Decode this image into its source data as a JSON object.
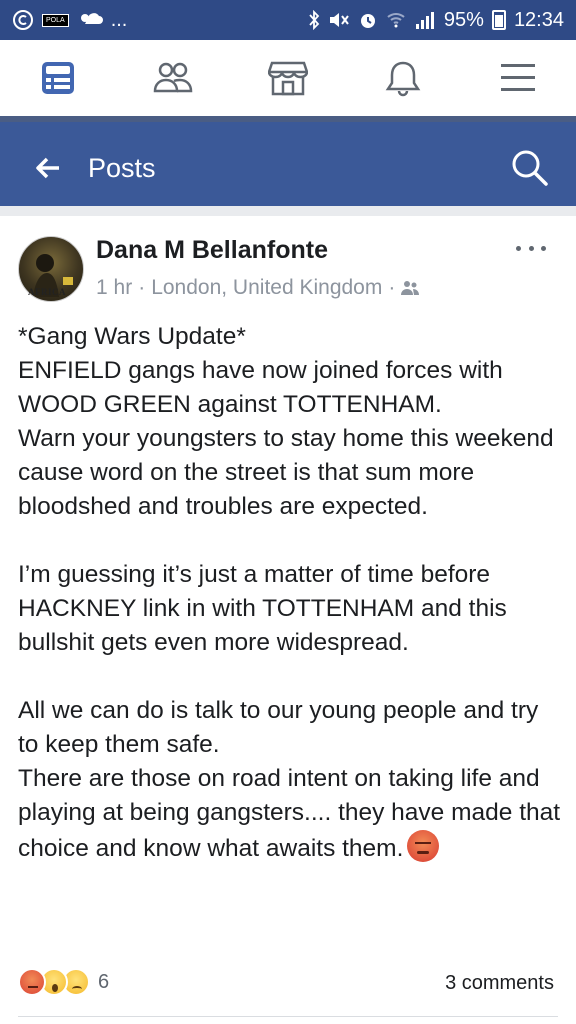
{
  "status_bar": {
    "left_badge": "POLA",
    "ellipsis": "...",
    "battery": "95%",
    "time": "12:34"
  },
  "tabs": [
    {
      "name": "news-feed-icon",
      "active": true
    },
    {
      "name": "friends-icon",
      "active": false
    },
    {
      "name": "marketplace-icon",
      "active": false
    },
    {
      "name": "notifications-icon",
      "active": false
    },
    {
      "name": "menu-icon",
      "active": false
    }
  ],
  "header": {
    "title": "Posts"
  },
  "post": {
    "author": "Dana M Bellanfonte",
    "avatar_label": "AFRICA",
    "time": "1 hr",
    "separator": "·",
    "location": "London, United Kingdom",
    "body": [
      "*Gang Wars Update*",
      "ENFIELD gangs have now joined forces with WOOD GREEN against TOTTENHAM.",
      "Warn your youngsters to stay home this weekend cause word on the street is that sum more bloodshed and troubles are expected.",
      "I’m guessing it’s just a matter of time before HACKNEY link in with TOTTENHAM and this bullshit gets even more widespread.",
      "All we can do is talk to our young people and try to keep them safe.",
      "There are those on road intent on taking life and playing at being gangsters.... they have made that choice and know what awaits them."
    ],
    "reaction_count": "6",
    "comments": "3 comments"
  },
  "colors": {
    "status_bar": "#2f4a86",
    "header": "#3b5998",
    "active_tab": "#4267b2",
    "icon_gray": "#606770"
  }
}
